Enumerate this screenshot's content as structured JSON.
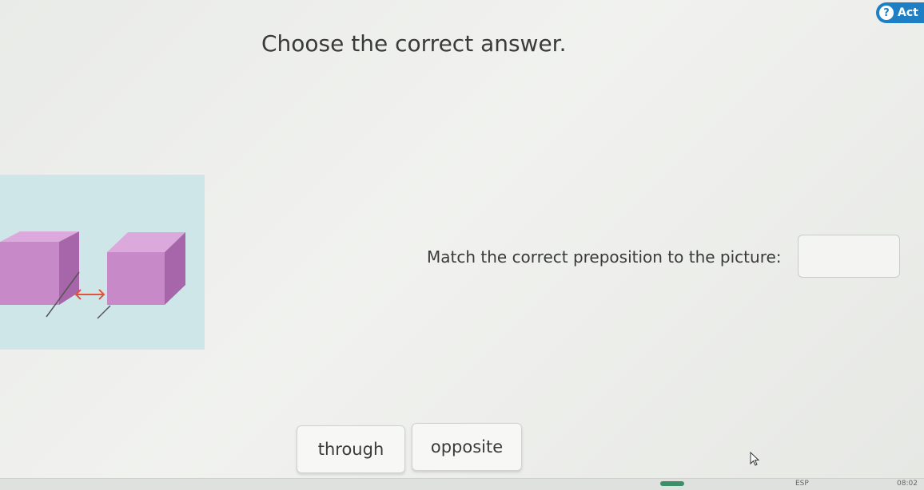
{
  "header": {
    "badge_label": "Act",
    "badge_icon": "help-icon"
  },
  "question": {
    "title": "Choose the correct answer.",
    "prompt": "Match the correct preposition to the picture:",
    "answer_slot_value": ""
  },
  "choices": [
    {
      "label": "through"
    },
    {
      "label": "opposite"
    }
  ],
  "taskbar": {
    "language": "ESP",
    "time": "08:02"
  },
  "colors": {
    "accent": "#1f7fc4",
    "cube": "#c889c9",
    "arrow": "#e0533f",
    "panel": "#cfe6e8"
  }
}
